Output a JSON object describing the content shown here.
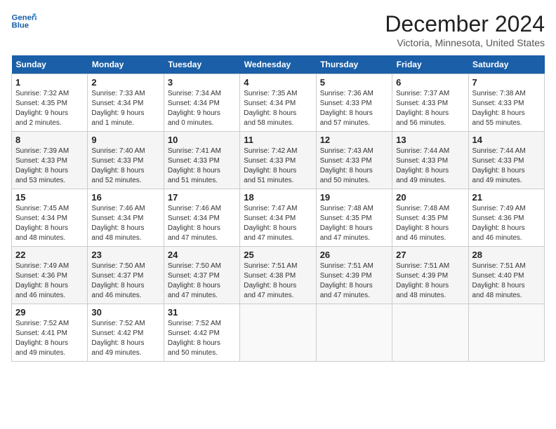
{
  "header": {
    "logo_line1": "General",
    "logo_line2": "Blue",
    "month_year": "December 2024",
    "location": "Victoria, Minnesota, United States"
  },
  "weekdays": [
    "Sunday",
    "Monday",
    "Tuesday",
    "Wednesday",
    "Thursday",
    "Friday",
    "Saturday"
  ],
  "weeks": [
    [
      {
        "day": "1",
        "info": "Sunrise: 7:32 AM\nSunset: 4:35 PM\nDaylight: 9 hours\nand 2 minutes."
      },
      {
        "day": "2",
        "info": "Sunrise: 7:33 AM\nSunset: 4:34 PM\nDaylight: 9 hours\nand 1 minute."
      },
      {
        "day": "3",
        "info": "Sunrise: 7:34 AM\nSunset: 4:34 PM\nDaylight: 9 hours\nand 0 minutes."
      },
      {
        "day": "4",
        "info": "Sunrise: 7:35 AM\nSunset: 4:34 PM\nDaylight: 8 hours\nand 58 minutes."
      },
      {
        "day": "5",
        "info": "Sunrise: 7:36 AM\nSunset: 4:33 PM\nDaylight: 8 hours\nand 57 minutes."
      },
      {
        "day": "6",
        "info": "Sunrise: 7:37 AM\nSunset: 4:33 PM\nDaylight: 8 hours\nand 56 minutes."
      },
      {
        "day": "7",
        "info": "Sunrise: 7:38 AM\nSunset: 4:33 PM\nDaylight: 8 hours\nand 55 minutes."
      }
    ],
    [
      {
        "day": "8",
        "info": "Sunrise: 7:39 AM\nSunset: 4:33 PM\nDaylight: 8 hours\nand 53 minutes."
      },
      {
        "day": "9",
        "info": "Sunrise: 7:40 AM\nSunset: 4:33 PM\nDaylight: 8 hours\nand 52 minutes."
      },
      {
        "day": "10",
        "info": "Sunrise: 7:41 AM\nSunset: 4:33 PM\nDaylight: 8 hours\nand 51 minutes."
      },
      {
        "day": "11",
        "info": "Sunrise: 7:42 AM\nSunset: 4:33 PM\nDaylight: 8 hours\nand 51 minutes."
      },
      {
        "day": "12",
        "info": "Sunrise: 7:43 AM\nSunset: 4:33 PM\nDaylight: 8 hours\nand 50 minutes."
      },
      {
        "day": "13",
        "info": "Sunrise: 7:44 AM\nSunset: 4:33 PM\nDaylight: 8 hours\nand 49 minutes."
      },
      {
        "day": "14",
        "info": "Sunrise: 7:44 AM\nSunset: 4:33 PM\nDaylight: 8 hours\nand 49 minutes."
      }
    ],
    [
      {
        "day": "15",
        "info": "Sunrise: 7:45 AM\nSunset: 4:34 PM\nDaylight: 8 hours\nand 48 minutes."
      },
      {
        "day": "16",
        "info": "Sunrise: 7:46 AM\nSunset: 4:34 PM\nDaylight: 8 hours\nand 48 minutes."
      },
      {
        "day": "17",
        "info": "Sunrise: 7:46 AM\nSunset: 4:34 PM\nDaylight: 8 hours\nand 47 minutes."
      },
      {
        "day": "18",
        "info": "Sunrise: 7:47 AM\nSunset: 4:34 PM\nDaylight: 8 hours\nand 47 minutes."
      },
      {
        "day": "19",
        "info": "Sunrise: 7:48 AM\nSunset: 4:35 PM\nDaylight: 8 hours\nand 47 minutes."
      },
      {
        "day": "20",
        "info": "Sunrise: 7:48 AM\nSunset: 4:35 PM\nDaylight: 8 hours\nand 46 minutes."
      },
      {
        "day": "21",
        "info": "Sunrise: 7:49 AM\nSunset: 4:36 PM\nDaylight: 8 hours\nand 46 minutes."
      }
    ],
    [
      {
        "day": "22",
        "info": "Sunrise: 7:49 AM\nSunset: 4:36 PM\nDaylight: 8 hours\nand 46 minutes."
      },
      {
        "day": "23",
        "info": "Sunrise: 7:50 AM\nSunset: 4:37 PM\nDaylight: 8 hours\nand 46 minutes."
      },
      {
        "day": "24",
        "info": "Sunrise: 7:50 AM\nSunset: 4:37 PM\nDaylight: 8 hours\nand 47 minutes."
      },
      {
        "day": "25",
        "info": "Sunrise: 7:51 AM\nSunset: 4:38 PM\nDaylight: 8 hours\nand 47 minutes."
      },
      {
        "day": "26",
        "info": "Sunrise: 7:51 AM\nSunset: 4:39 PM\nDaylight: 8 hours\nand 47 minutes."
      },
      {
        "day": "27",
        "info": "Sunrise: 7:51 AM\nSunset: 4:39 PM\nDaylight: 8 hours\nand 48 minutes."
      },
      {
        "day": "28",
        "info": "Sunrise: 7:51 AM\nSunset: 4:40 PM\nDaylight: 8 hours\nand 48 minutes."
      }
    ],
    [
      {
        "day": "29",
        "info": "Sunrise: 7:52 AM\nSunset: 4:41 PM\nDaylight: 8 hours\nand 49 minutes."
      },
      {
        "day": "30",
        "info": "Sunrise: 7:52 AM\nSunset: 4:42 PM\nDaylight: 8 hours\nand 49 minutes."
      },
      {
        "day": "31",
        "info": "Sunrise: 7:52 AM\nSunset: 4:42 PM\nDaylight: 8 hours\nand 50 minutes."
      },
      null,
      null,
      null,
      null
    ]
  ]
}
